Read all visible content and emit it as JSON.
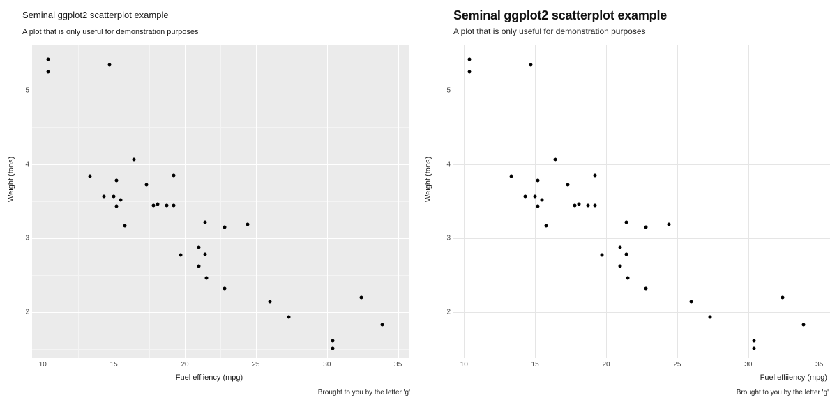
{
  "chart_data": [
    {
      "type": "scatter",
      "title": "Seminal ggplot2 scatterplot example",
      "subtitle": "A plot that is only useful for demonstration purposes",
      "caption": "Brought to you by the letter 'g'",
      "xlabel": "Fuel effiiency (mpg)",
      "ylabel": "Weight (tons)",
      "xlim": [
        10,
        35
      ],
      "ylim": [
        1.5,
        5.5
      ],
      "x_grid_minor": [
        12.5,
        17.5,
        22.5,
        27.5,
        32.5
      ],
      "y_grid_minor": [
        1.5,
        2.5,
        3.5,
        4.5,
        5.5
      ],
      "x_ticks": [
        10,
        15,
        20,
        25,
        30,
        35
      ],
      "y_ticks": [
        2,
        3,
        4,
        5
      ],
      "theme": "grey",
      "x": [
        21.0,
        21.0,
        22.8,
        21.4,
        18.7,
        18.1,
        14.3,
        24.4,
        22.8,
        19.2,
        17.8,
        16.4,
        17.3,
        15.2,
        10.4,
        10.4,
        14.7,
        32.4,
        30.4,
        33.9,
        21.5,
        15.5,
        15.2,
        13.3,
        19.2,
        27.3,
        26.0,
        30.4,
        15.8,
        19.7,
        15.0,
        21.4
      ],
      "y": [
        2.62,
        2.875,
        2.32,
        3.215,
        3.44,
        3.46,
        3.57,
        3.19,
        3.15,
        3.44,
        3.44,
        4.07,
        3.73,
        3.78,
        5.25,
        5.424,
        5.345,
        2.2,
        1.615,
        1.835,
        2.465,
        3.52,
        3.435,
        3.84,
        3.845,
        1.935,
        2.14,
        1.513,
        3.17,
        2.77,
        3.57,
        2.78
      ]
    },
    {
      "type": "scatter",
      "title": "Seminal ggplot2 scatterplot example",
      "subtitle": "A plot that is only useful for demonstration purposes",
      "caption": "Brought to you by the letter 'g'",
      "xlabel": "Fuel effiiency (mpg)",
      "ylabel": "Weight (tons)",
      "xlim": [
        10,
        35
      ],
      "ylim": [
        1.5,
        5.5
      ],
      "x_ticks": [
        10,
        15,
        20,
        25,
        30,
        35
      ],
      "y_ticks": [
        2,
        3,
        4,
        5
      ],
      "theme": "ipsum",
      "x": [
        21.0,
        21.0,
        22.8,
        21.4,
        18.7,
        18.1,
        14.3,
        24.4,
        22.8,
        19.2,
        17.8,
        16.4,
        17.3,
        15.2,
        10.4,
        10.4,
        14.7,
        32.4,
        30.4,
        33.9,
        21.5,
        15.5,
        15.2,
        13.3,
        19.2,
        27.3,
        26.0,
        30.4,
        15.8,
        19.7,
        15.0,
        21.4
      ],
      "y": [
        2.62,
        2.875,
        2.32,
        3.215,
        3.44,
        3.46,
        3.57,
        3.19,
        3.15,
        3.44,
        3.44,
        4.07,
        3.73,
        3.78,
        5.25,
        5.424,
        5.345,
        2.2,
        1.615,
        1.835,
        2.465,
        3.52,
        3.435,
        3.84,
        3.845,
        1.935,
        2.14,
        1.513,
        3.17,
        2.77,
        3.57,
        2.78
      ]
    }
  ]
}
